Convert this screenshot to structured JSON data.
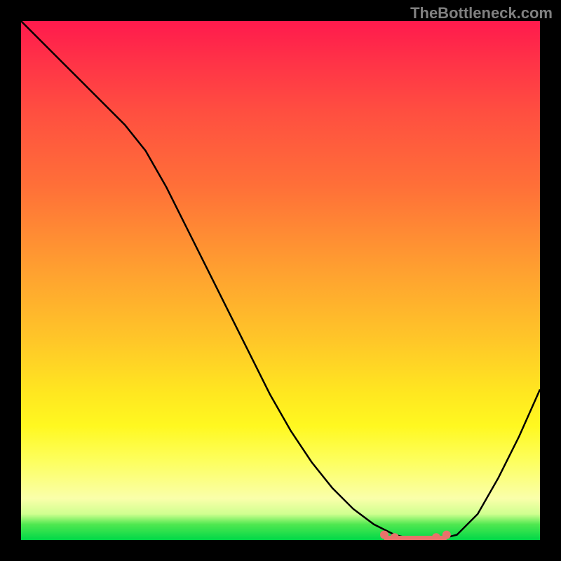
{
  "watermark": "TheBottleneck.com",
  "chart_data": {
    "type": "line",
    "title": "",
    "xlabel": "",
    "ylabel": "",
    "xlim": [
      0,
      100
    ],
    "ylim": [
      0,
      100
    ],
    "x": [
      0,
      4,
      8,
      12,
      16,
      20,
      24,
      28,
      32,
      36,
      40,
      44,
      48,
      52,
      56,
      60,
      64,
      68,
      72,
      76,
      80,
      84,
      88,
      92,
      96,
      100
    ],
    "values": [
      100,
      96,
      92,
      88,
      84,
      80,
      75,
      68,
      60,
      52,
      44,
      36,
      28,
      21,
      15,
      10,
      6,
      3,
      1,
      0,
      0,
      1,
      5,
      12,
      20,
      29
    ],
    "marker_points_x": [
      70,
      72,
      74,
      76,
      78,
      80,
      82
    ],
    "marker_points_y": [
      1,
      0.5,
      0,
      0,
      0,
      0.5,
      1
    ],
    "gradient_stops": [
      {
        "pos": 0,
        "color": "#ff1a4d"
      },
      {
        "pos": 50,
        "color": "#ffb030"
      },
      {
        "pos": 85,
        "color": "#ffff60"
      },
      {
        "pos": 100,
        "color": "#00d848"
      }
    ]
  }
}
